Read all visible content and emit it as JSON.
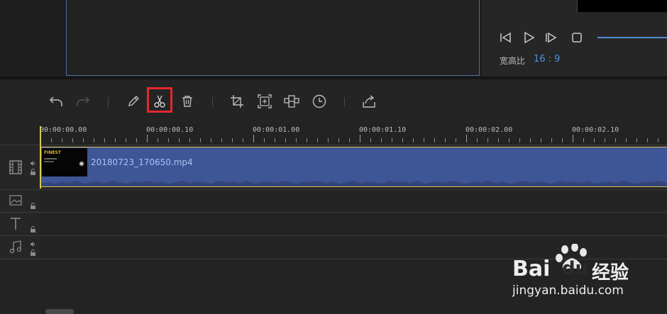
{
  "preview": {
    "aspect_ratio_label": "宽高比",
    "aspect_ratio_value": "16 : 9"
  },
  "player_controls": [
    "prev-frame",
    "play",
    "next-frame",
    "stop"
  ],
  "toolbar": {
    "buttons": [
      "undo",
      "redo",
      "edit",
      "cut",
      "delete",
      "crop",
      "zoom",
      "mosaic",
      "duration",
      "export"
    ],
    "highlighted": "cut",
    "highlight_color": "#e5282b"
  },
  "ruler": {
    "labels": [
      "00:00:00.00",
      "00:00:00.10",
      "00:00:01.00",
      "00:00:01.10",
      "00:00:02.00",
      "00:00:02.10"
    ]
  },
  "timeline": {
    "clip_name": "20180723_170650.mp4",
    "clip_thumb_text": "FINEST",
    "clip_color": "#3e5596",
    "tracks": [
      "video",
      "image",
      "text",
      "audio"
    ]
  },
  "watermark": {
    "brand": "Bai",
    "brand2": "du",
    "brand_cn": "经验",
    "url": "jingyan.baidu.com"
  },
  "colors": {
    "accent_blue": "#4f93d8",
    "playhead": "#e0c84e",
    "background": "#232323"
  }
}
